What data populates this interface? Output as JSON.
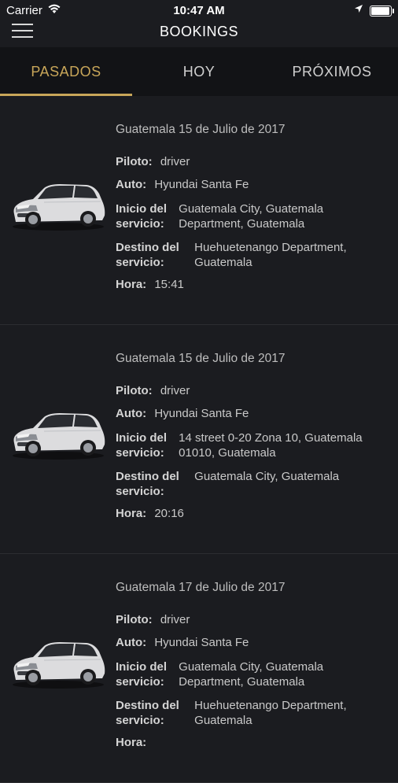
{
  "status_bar": {
    "carrier": "Carrier",
    "time": "10:47 AM",
    "battery_level": 0.95
  },
  "nav": {
    "title": "BOOKINGS"
  },
  "tabs": [
    {
      "label": "PASADOS",
      "active": true
    },
    {
      "label": "HOY",
      "active": false
    },
    {
      "label": "PRÓXIMOS",
      "active": false
    }
  ],
  "labels": {
    "pilot": "Piloto:",
    "car": "Auto:",
    "start_1": "Inicio del",
    "start_2": "servicio:",
    "dest_1": "Destino del",
    "dest_2": "servicio:",
    "time": "Hora:"
  },
  "bookings": [
    {
      "date": "Guatemala 15 de Julio de 2017",
      "pilot": "driver",
      "car": "Hyundai Santa Fe",
      "start_line1": "Guatemala City, Guatemala",
      "start_line2": "Department, Guatemala",
      "dest_line1": "Huehuetenango Department,",
      "dest_line2": "Guatemala",
      "time": "15:41"
    },
    {
      "date": "Guatemala 15 de Julio de 2017",
      "pilot": "driver",
      "car": "Hyundai Santa Fe",
      "start_line1": "14 street 0-20 Zona 10, Guatemala",
      "start_line2": "01010, Guatemala",
      "dest_line1": "Guatemala City, Guatemala",
      "dest_line2": "",
      "time": "20:16"
    },
    {
      "date": "Guatemala 17 de Julio de 2017",
      "pilot": "driver",
      "car": "Hyundai Santa Fe",
      "start_line1": "Guatemala City, Guatemala",
      "start_line2": "Department, Guatemala",
      "dest_line1": "Huehuetenango Department,",
      "dest_line2": "Guatemala",
      "time": ""
    }
  ],
  "colors": {
    "accent": "#c8a659",
    "background": "#1b1c20",
    "tabbar": "#121316"
  },
  "icons": [
    "wifi-icon",
    "location-arrow-icon",
    "battery-icon",
    "hamburger-menu-icon",
    "car-image"
  ]
}
